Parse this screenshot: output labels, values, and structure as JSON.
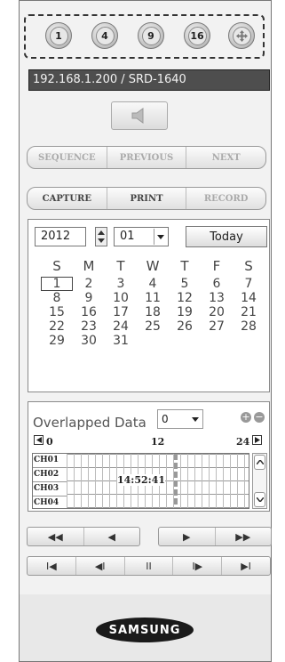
{
  "split_buttons": [
    {
      "label": "1"
    },
    {
      "label": "4"
    },
    {
      "label": "9"
    },
    {
      "label": "16"
    },
    {
      "icon": "move-arrows-icon"
    }
  ],
  "device": {
    "info": "192.168.1.200  / SRD-1640"
  },
  "audio": {
    "icon": "speaker-icon"
  },
  "nav_buttons": {
    "sequence": "SEQUENCE",
    "previous": "PREVIOUS",
    "next": "NEXT"
  },
  "action_buttons": {
    "capture": "CAPTURE",
    "print": "PRINT",
    "record": "RECORD"
  },
  "calendar": {
    "year": "2012",
    "month": "01",
    "today_label": "Today",
    "weekdays": [
      "S",
      "M",
      "T",
      "W",
      "T",
      "F",
      "S"
    ],
    "days": [
      [
        "1",
        "2",
        "3",
        "4",
        "5",
        "6",
        "7"
      ],
      [
        "8",
        "9",
        "10",
        "11",
        "12",
        "13",
        "14"
      ],
      [
        "15",
        "16",
        "17",
        "18",
        "19",
        "20",
        "21"
      ],
      [
        "22",
        "23",
        "24",
        "25",
        "26",
        "27",
        "28"
      ],
      [
        "29",
        "30",
        "31",
        "",
        "",
        "",
        ""
      ]
    ],
    "selected_day": "1"
  },
  "overlapped": {
    "title": "Overlapped Data",
    "select_value": "0",
    "time_labels": [
      "0",
      "12",
      "24"
    ],
    "channels": [
      "CH01",
      "CH02",
      "CH03",
      "CH04"
    ],
    "current_time": "14:52:41"
  },
  "playback_row1": [
    "◀◀",
    "◀",
    "▶",
    "▶▶"
  ],
  "playback_row2": [
    "I◀",
    "◀I",
    "II",
    "I▶",
    "▶I"
  ],
  "brand": "SAMSUNG",
  "colors": {
    "accent": "#4e4e4e",
    "panel": "#f2f2f2"
  }
}
